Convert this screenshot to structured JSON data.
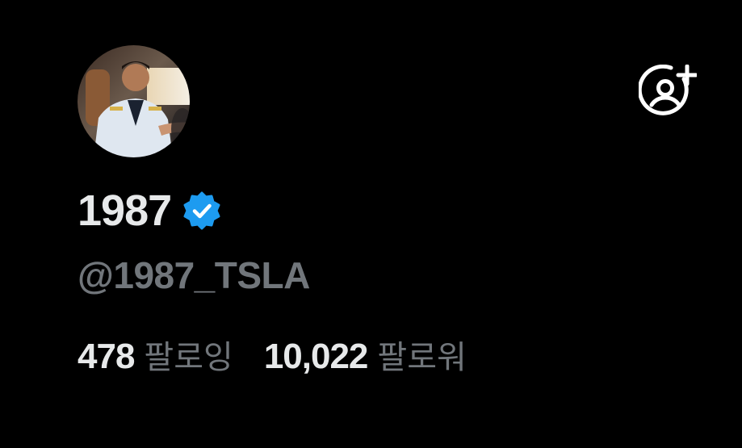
{
  "profile": {
    "display_name": "1987",
    "handle": "@1987_TSLA",
    "verified": true,
    "avatar_icon": "profile-photo"
  },
  "actions": {
    "follow_icon": "add-user-icon"
  },
  "stats": {
    "following_count": "478",
    "following_label": "팔로잉",
    "followers_count": "10,022",
    "followers_label": "팔로워"
  },
  "colors": {
    "background": "#000000",
    "primary_text": "#e7e9ea",
    "secondary_text": "#71767b",
    "verified_blue": "#1d9bf0"
  }
}
